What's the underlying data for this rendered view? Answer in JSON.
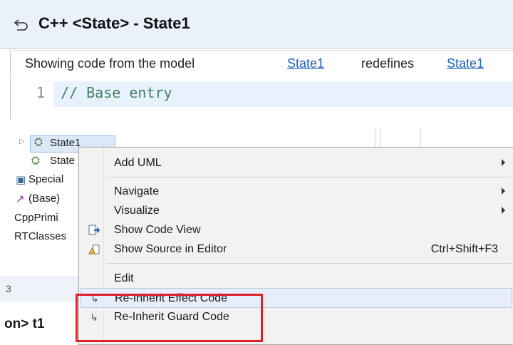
{
  "panel": {
    "title": "C++ <State> - State1",
    "info_text": "Showing code from the model",
    "link_1": "State1",
    "redefines_text": "redefines",
    "link_2": "State1",
    "line_number": "1",
    "code_line": "// Base entry"
  },
  "tree": {
    "rows": [
      "State1",
      "State",
      "Special",
      "(Base)",
      "CppPrimi",
      "RTClasses"
    ],
    "tab_label": "3",
    "bottom_label": "on> t1"
  },
  "menu": {
    "items": [
      {
        "label": "Add UML",
        "submenu": true
      },
      {
        "label": "Navigate",
        "submenu": true
      },
      {
        "label": "Visualize",
        "submenu": true
      },
      {
        "label": "Show Code View",
        "icon": "show-code-view-icon"
      },
      {
        "label": "Show Source in Editor",
        "shortcut": "Ctrl+Shift+F3",
        "icon": "show-source-icon"
      },
      {
        "label": "Edit"
      },
      {
        "label": "Re-Inherit Effect Code",
        "icon": "reinherit-icon"
      },
      {
        "label": "Re-Inherit Guard Code",
        "icon": "reinherit-icon"
      }
    ]
  },
  "colors": {
    "link": "#1f63b8",
    "highlight_box": "#e0202a",
    "comment": "#3f7f5f"
  }
}
